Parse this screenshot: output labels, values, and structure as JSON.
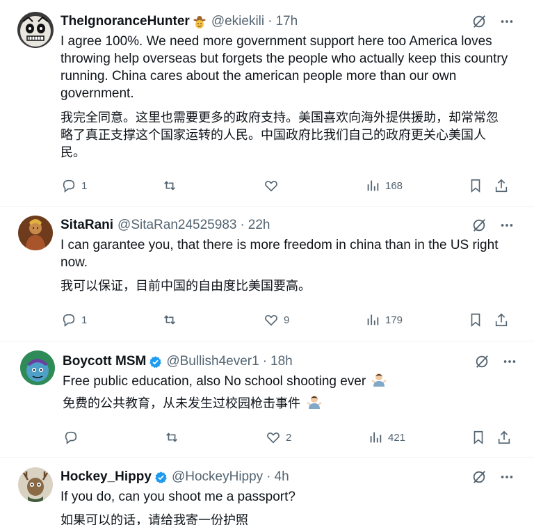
{
  "tweets": [
    {
      "name": "TheIgnoranceHunter",
      "name_emoji": "cowboy-emoji",
      "handle": "@ekiekili",
      "time": "17h",
      "verified": false,
      "text_en": "I agree 100%. We need more government support here too America loves throwing help overseas but forgets the people who actually keep this country running. China cares about the american people more than our own government.",
      "text_zh": "我完全同意。这里也需要更多的政府支持。美国喜欢向海外提供援助，却常常忽略了真正支撑这个国家运转的人民。中国政府比我们自己的政府更关心美国人民。",
      "replies": "1",
      "reposts": "",
      "likes": "",
      "views": "168"
    },
    {
      "name": "SitaRani",
      "handle": "@SitaRan24525983",
      "time": "22h",
      "verified": false,
      "text_en": "I can garantee you, that there is more freedom in china than in the US right now.",
      "text_zh": "我可以保证，目前中国的自由度比美国要高。",
      "replies": "1",
      "reposts": "",
      "likes": "9",
      "views": "179"
    },
    {
      "name": "Boycott MSM",
      "handle": "@Bullish4ever1",
      "time": "18h",
      "verified": true,
      "text_en": "Free public education, also No school shooting ever",
      "text_emoji": "man-shrugging-emoji",
      "text_zh": "免费的公共教育，从未发生过校园枪击事件",
      "replies": "",
      "reposts": "",
      "likes": "2",
      "views": "421"
    },
    {
      "name": "Hockey_Hippy",
      "handle": "@HockeyHippy",
      "time": "4h",
      "verified": true,
      "text_en": "If you do, can you shoot me a passport?",
      "text_zh": "如果可以的话，请给我寄一份护照"
    }
  ],
  "sep": "·",
  "colors": {
    "text": "#0f1419",
    "muted": "#536471",
    "verified": "#1d9bf0",
    "divider": "#eff3f4"
  },
  "icons": [
    "grok-icon",
    "more-icon",
    "reply-icon",
    "repost-icon",
    "like-icon",
    "views-icon",
    "bookmark-icon",
    "share-icon"
  ]
}
